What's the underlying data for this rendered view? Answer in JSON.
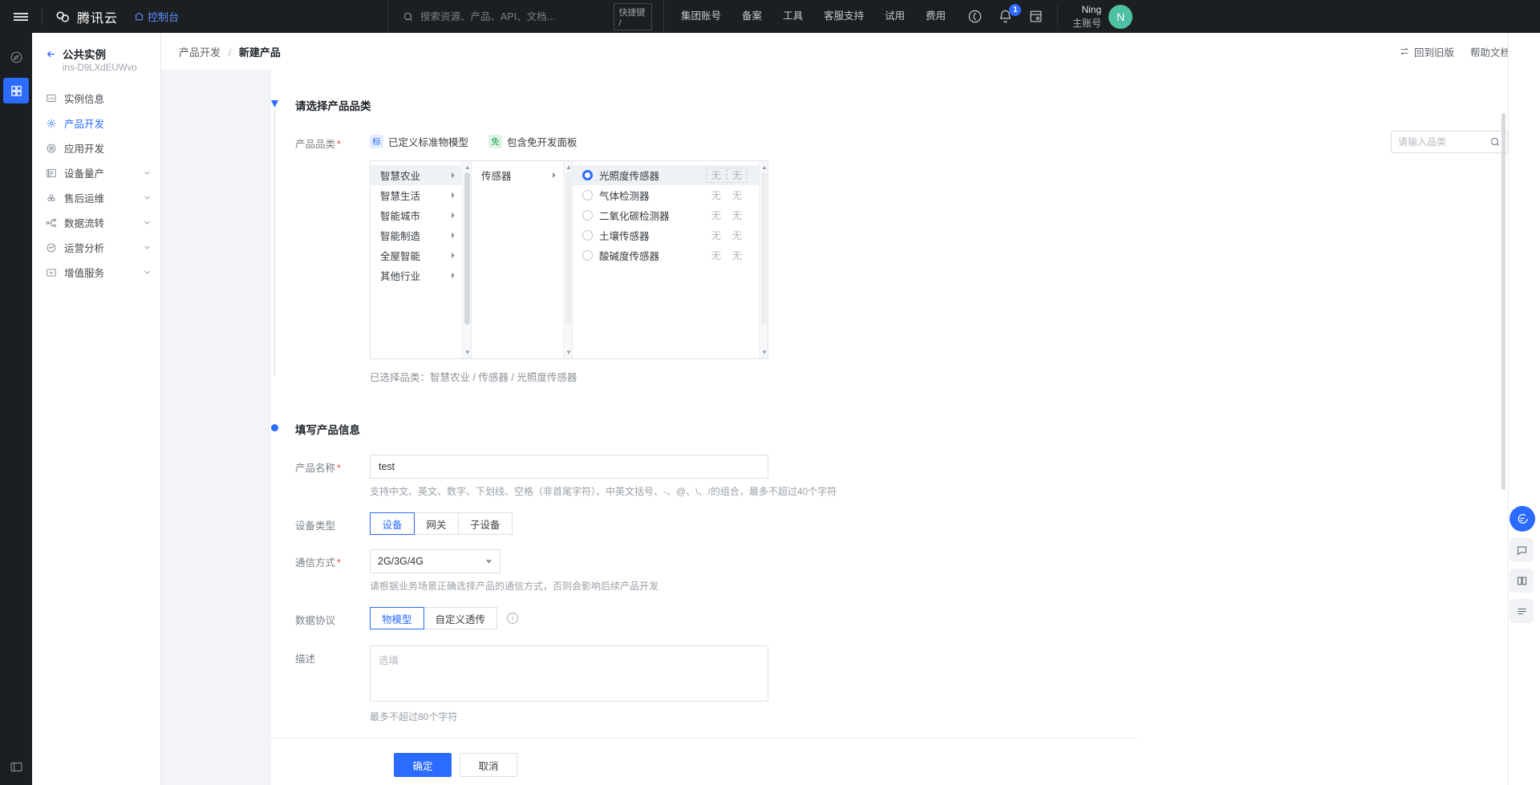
{
  "header": {
    "brand": "腾讯云",
    "console": "控制台",
    "search_placeholder": "搜索资源、产品、API、文档...",
    "kbd_hint": "快捷键 /",
    "nav": [
      {
        "label": "集团账号"
      },
      {
        "label": "备案"
      },
      {
        "label": "工具"
      },
      {
        "label": "客服支持"
      },
      {
        "label": "试用"
      },
      {
        "label": "费用"
      }
    ],
    "notification_count": "1",
    "user_name": "Ning",
    "user_role": "主账号",
    "avatar_letter": "N"
  },
  "sidebar": {
    "instance_name": "公共实例",
    "instance_id": "ins-D9LXdEUWvo",
    "items": [
      {
        "label": "实例信息",
        "icon": "dashboard-icon",
        "active": false,
        "expandable": false
      },
      {
        "label": "产品开发",
        "icon": "gear-icon",
        "active": true,
        "expandable": false
      },
      {
        "label": "应用开发",
        "icon": "target-icon",
        "active": false,
        "expandable": false
      },
      {
        "label": "设备量产",
        "icon": "list-icon",
        "active": false,
        "expandable": true
      },
      {
        "label": "售后运维",
        "icon": "cloud-icon",
        "active": false,
        "expandable": true
      },
      {
        "label": "数据流转",
        "icon": "flow-icon",
        "active": false,
        "expandable": true
      },
      {
        "label": "运营分析",
        "icon": "analytics-icon",
        "active": false,
        "expandable": true
      },
      {
        "label": "增值服务",
        "icon": "value-icon",
        "active": false,
        "expandable": true
      }
    ]
  },
  "breadcrumb": {
    "parent": "产品开发",
    "separator": "/",
    "current": "新建产品"
  },
  "page_actions": [
    {
      "label": "回到旧版",
      "icon": "swap-icon"
    },
    {
      "label": "帮助文档",
      "icon": "external-link-icon"
    }
  ],
  "step1": {
    "title": "请选择产品品类",
    "field_label": "产品品类",
    "tags": [
      {
        "badge": "标",
        "label": "已定义标准物模型",
        "color": "#2b6bff"
      },
      {
        "badge": "免",
        "label": "包含免开发面板",
        "color": "#21a35c"
      }
    ],
    "search_placeholder": "请输入品类",
    "column1": [
      {
        "label": "智慧农业",
        "selected": true
      },
      {
        "label": "智慧生活",
        "selected": false
      },
      {
        "label": "智能城市",
        "selected": false
      },
      {
        "label": "智能制造",
        "selected": false
      },
      {
        "label": "全屋智能",
        "selected": false
      },
      {
        "label": "其他行业",
        "selected": false
      }
    ],
    "column2": [
      {
        "label": "传感器",
        "selected": false
      }
    ],
    "column3": [
      {
        "label": "光照度传感器",
        "selected": true,
        "col_a": "无",
        "col_b": "无"
      },
      {
        "label": "气体检测器",
        "selected": false,
        "col_a": "无",
        "col_b": "无"
      },
      {
        "label": "二氧化碳检测器",
        "selected": false,
        "col_a": "无",
        "col_b": "无"
      },
      {
        "label": "土壤传感器",
        "selected": false,
        "col_a": "无",
        "col_b": "无"
      },
      {
        "label": "酸碱度传感器",
        "selected": false,
        "col_a": "无",
        "col_b": "无"
      }
    ],
    "selected_path": "已选择品类：智慧农业 / 传感器 / 光照度传感器"
  },
  "step2": {
    "title": "填写产品信息",
    "product_name": {
      "label": "产品名称",
      "value": "test",
      "hint": "支持中文、英文、数字、下划线、空格（非首尾字符）、中英文括号、-、@、\\、/的组合，最多不超过40个字符"
    },
    "device_type": {
      "label": "设备类型",
      "options": [
        {
          "label": "设备",
          "on": true
        },
        {
          "label": "网关",
          "on": false
        },
        {
          "label": "子设备",
          "on": false
        }
      ]
    },
    "comm_method": {
      "label": "通信方式",
      "value": "2G/3G/4G",
      "hint": "请根据业务场景正确选择产品的通信方式，否则会影响后续产品开发"
    },
    "data_protocol": {
      "label": "数据协议",
      "options": [
        {
          "label": "物模型",
          "on": true
        },
        {
          "label": "自定义透传",
          "on": false
        }
      ]
    },
    "description": {
      "label": "描述",
      "placeholder": "选填",
      "hint": "最多不超过80个字符"
    }
  },
  "footer": {
    "submit": "确定",
    "cancel": "取消"
  },
  "float_buttons": [
    {
      "icon": "chat-icon",
      "name": "support-chat"
    },
    {
      "icon": "feedback-icon",
      "name": "feedback"
    },
    {
      "icon": "docs-icon",
      "name": "docs"
    },
    {
      "icon": "more-icon",
      "name": "more"
    }
  ]
}
